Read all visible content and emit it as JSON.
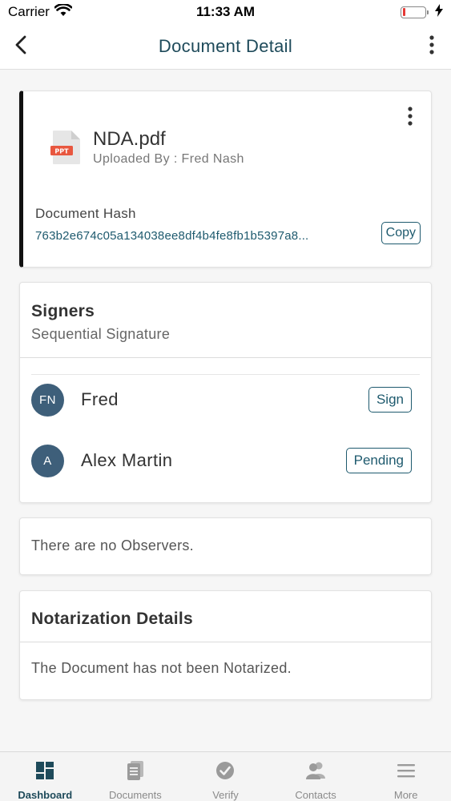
{
  "status_bar": {
    "carrier": "Carrier",
    "time": "11:33 AM",
    "battery_level": 0.12
  },
  "nav": {
    "title": "Document Detail"
  },
  "document": {
    "file_icon_badge": "PPT",
    "name": "NDA.pdf",
    "uploaded_by": "Uploaded By : Fred Nash",
    "hash_label": "Document Hash",
    "hash_value": "763b2e674c05a134038ee8df4b4fe8fb1b5397a8...",
    "copy_label": "Copy"
  },
  "signers": {
    "title": "Signers",
    "subtitle": "Sequential Signature",
    "items": [
      {
        "initials": "FN",
        "name": "Fred",
        "action": "Sign"
      },
      {
        "initials": "A",
        "name": "Alex Martin",
        "action": "Pending"
      }
    ]
  },
  "observers": {
    "text": "There are no Observers."
  },
  "notarization": {
    "title": "Notarization Details",
    "text": "The Document has not been Notarized."
  },
  "tabs": [
    {
      "label": "Dashboard",
      "icon": "dashboard-icon",
      "active": true
    },
    {
      "label": "Documents",
      "icon": "documents-icon",
      "active": false
    },
    {
      "label": "Verify",
      "icon": "verify-icon",
      "active": false
    },
    {
      "label": "Contacts",
      "icon": "contacts-icon",
      "active": false
    },
    {
      "label": "More",
      "icon": "menu-icon",
      "active": false
    }
  ],
  "colors": {
    "accent": "#1e5a6e",
    "title": "#1e4a5a",
    "avatar": "#3e5f7a",
    "battery_low": "#e53935",
    "file_badge": "#e8573f"
  }
}
